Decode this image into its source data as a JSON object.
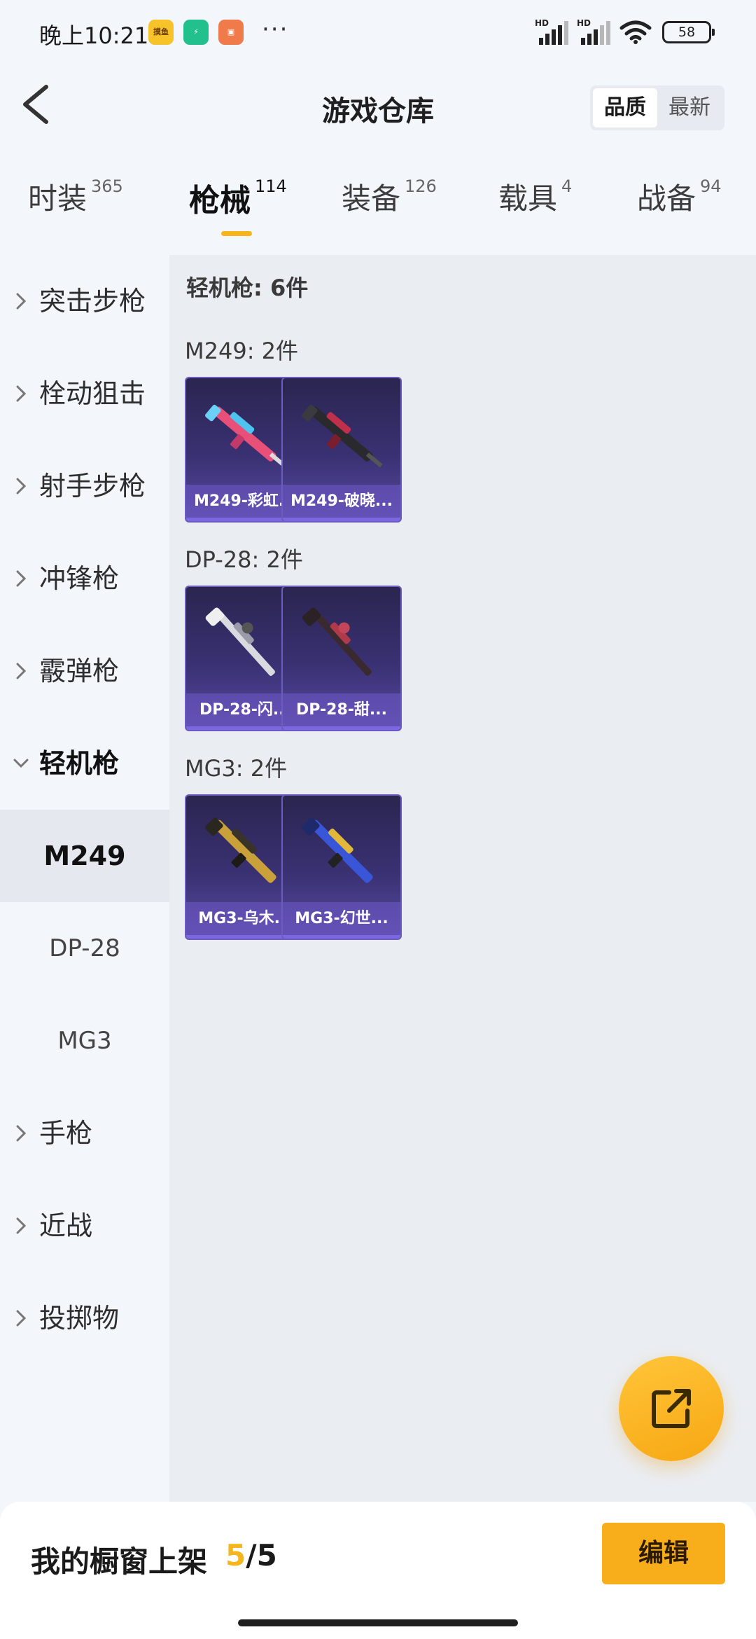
{
  "status_bar": {
    "time": "晚上10:21",
    "app_icon_1": "摸鱼",
    "more": "···",
    "signal_1_label": "HD",
    "signal_2_label": "HD",
    "battery": "58"
  },
  "header": {
    "title": "游戏仓库",
    "sort_quality": "品质",
    "sort_newest": "最新"
  },
  "tabs": [
    {
      "label": "时装",
      "count": "365"
    },
    {
      "label": "枪械",
      "count": "114"
    },
    {
      "label": "装备",
      "count": "126"
    },
    {
      "label": "载具",
      "count": "4"
    },
    {
      "label": "战备",
      "count": "94"
    }
  ],
  "sidebar": {
    "items": [
      {
        "label": "突击步枪"
      },
      {
        "label": "栓动狙击"
      },
      {
        "label": "射手步枪"
      },
      {
        "label": "冲锋枪"
      },
      {
        "label": "霰弹枪"
      },
      {
        "label": "轻机枪"
      },
      {
        "label": "手枪"
      },
      {
        "label": "近战"
      },
      {
        "label": "投掷物"
      }
    ],
    "subitems": [
      {
        "label": "M249"
      },
      {
        "label": "DP-28"
      },
      {
        "label": "MG3"
      }
    ]
  },
  "content": {
    "category_title": "轻机枪: 6件",
    "groups": [
      {
        "title": "M249: 2件",
        "items": [
          {
            "name": "M249-彩虹..."
          },
          {
            "name": "M249-破晓..."
          }
        ]
      },
      {
        "title": "DP-28: 2件",
        "items": [
          {
            "name": "DP-28-闪..."
          },
          {
            "name": "DP-28-甜..."
          }
        ]
      },
      {
        "title": "MG3: 2件",
        "items": [
          {
            "name": "MG3-乌木..."
          },
          {
            "name": "MG3-幻世..."
          }
        ]
      }
    ]
  },
  "bottom": {
    "shelf_label": "我的橱窗上架",
    "shelf_current": "5",
    "shelf_sep": "/",
    "shelf_max": "5",
    "edit_label": "编辑"
  },
  "colors": {
    "accent": "#f7ae1a",
    "card_bg": "#3a3173",
    "page_bg": "#f3f6fb",
    "content_bg": "#eaedf2"
  }
}
